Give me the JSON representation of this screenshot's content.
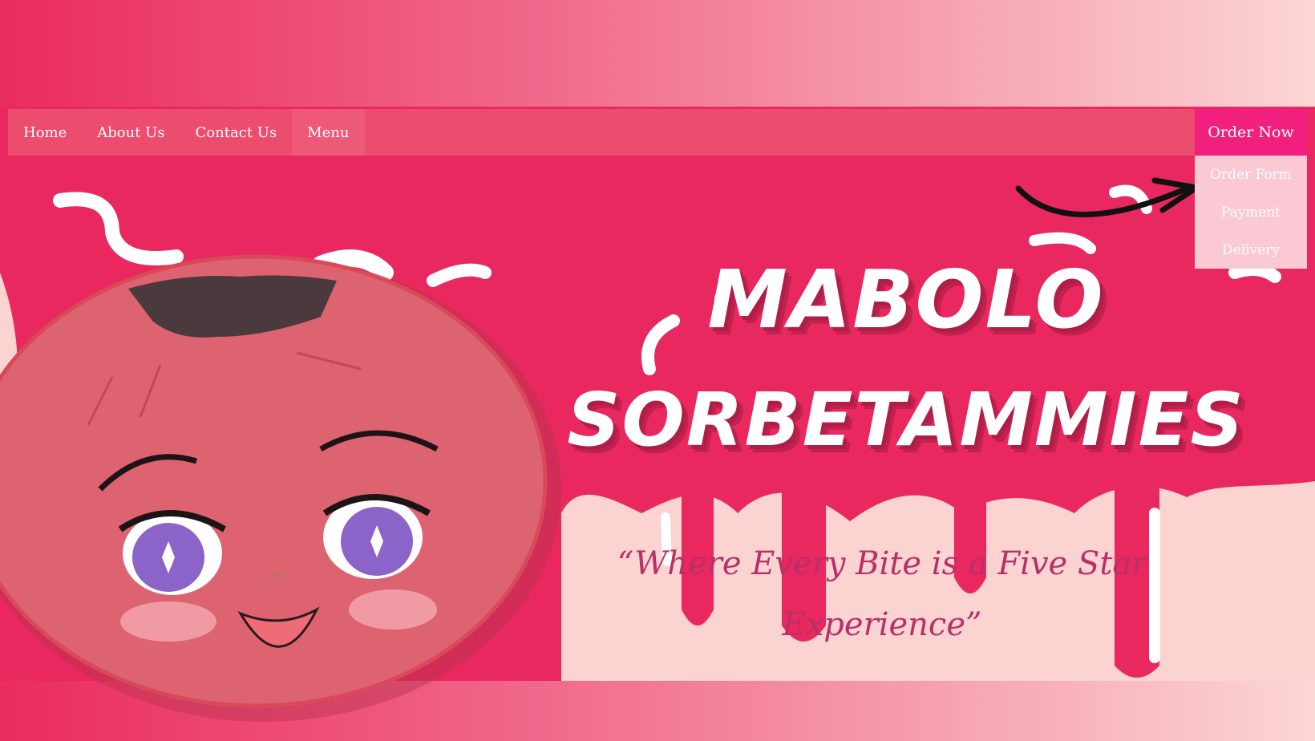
{
  "nav": {
    "items": [
      {
        "label": "Home"
      },
      {
        "label": "About Us"
      },
      {
        "label": "Contact Us"
      },
      {
        "label": "Menu"
      }
    ],
    "order_now": "Order Now"
  },
  "order_dropdown": {
    "items": [
      {
        "label": "Order Form"
      },
      {
        "label": "Payment"
      },
      {
        "label": "Delivery"
      }
    ]
  },
  "hero": {
    "title_line1": "MABOLO",
    "title_line2": "SORBETAMMIES",
    "tagline": "“Where Every Bite is a Five Star Experience”"
  },
  "colors": {
    "hero_bg": "#e8285e",
    "nav_bg": "#ec4d6e",
    "order_now_bg": "#f1207f",
    "dropdown_bg": "#fbc9d4",
    "drip_bg": "#fbd3d0",
    "tagline": "#b8306a"
  }
}
